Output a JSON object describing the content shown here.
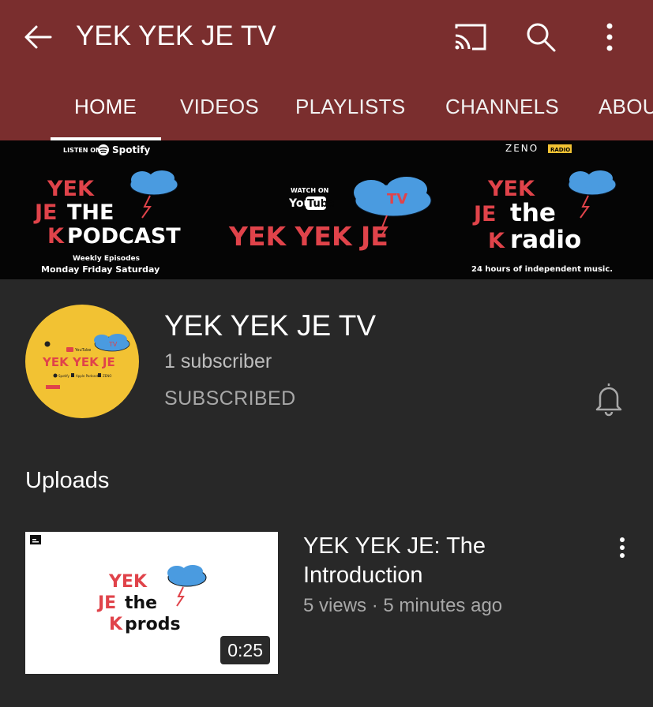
{
  "appbar": {
    "title": "YEK YEK JE TV",
    "icons": [
      "back-arrow-icon",
      "cast-icon",
      "search-icon",
      "more-vert-icon"
    ],
    "background": "#7a2e2e"
  },
  "tabs": [
    {
      "label": "HOME",
      "selected": true
    },
    {
      "label": "VIDEOS",
      "selected": false
    },
    {
      "label": "PLAYLISTS",
      "selected": false
    },
    {
      "label": "CHANNELS",
      "selected": false
    },
    {
      "label": "ABOUT",
      "selected": false
    }
  ],
  "banner": {
    "left": {
      "listen_on": "LISTEN ON",
      "spotify": "Spotify",
      "line1": "YEK",
      "line2_a": "JE",
      "line2_b": "THE",
      "line3_a": "K",
      "line3_b": "PODCAST",
      "caption1": "Weekly Episodes",
      "caption2": "Monday Friday Saturday"
    },
    "center": {
      "watch_on": "WATCH ON",
      "youtube_a": "You",
      "youtube_b": "Tube",
      "tv": "TV",
      "name": "YEK YEK JE"
    },
    "right": {
      "zeno": "ZENO",
      "zeno_badge": "RADIO",
      "line1": "YEK",
      "line2_a": "JE",
      "line2_b": "the",
      "line3_a": "K",
      "line3_b": "radio",
      "caption": "24 hours of independent music."
    }
  },
  "channel": {
    "name": "YEK YEK JE TV",
    "subscribers": "1 subscriber",
    "subscribe_state": "SUBSCRIBED",
    "avatar": {
      "tv": "TV",
      "youtube": "YouTube",
      "name": "YEK YEK JE",
      "spotify": "Spotify",
      "apple": "Apple Podcasts",
      "zeno": "ZENO"
    },
    "avatar_color": "#f2c233"
  },
  "section": {
    "title": "Uploads"
  },
  "videos": [
    {
      "title": "YEK YEK JE: The Introduction",
      "views": "5 views",
      "separator": "·",
      "age": "5 minutes ago",
      "duration": "0:25",
      "thumb": {
        "line1": "YEK",
        "line2_a": "JE",
        "line2_b": "the",
        "line3_a": "K",
        "line3_b": "prods"
      }
    }
  ],
  "colors": {
    "background": "#282828",
    "accent_red": "#e0434a",
    "cloud_blue": "#4a9be0"
  }
}
